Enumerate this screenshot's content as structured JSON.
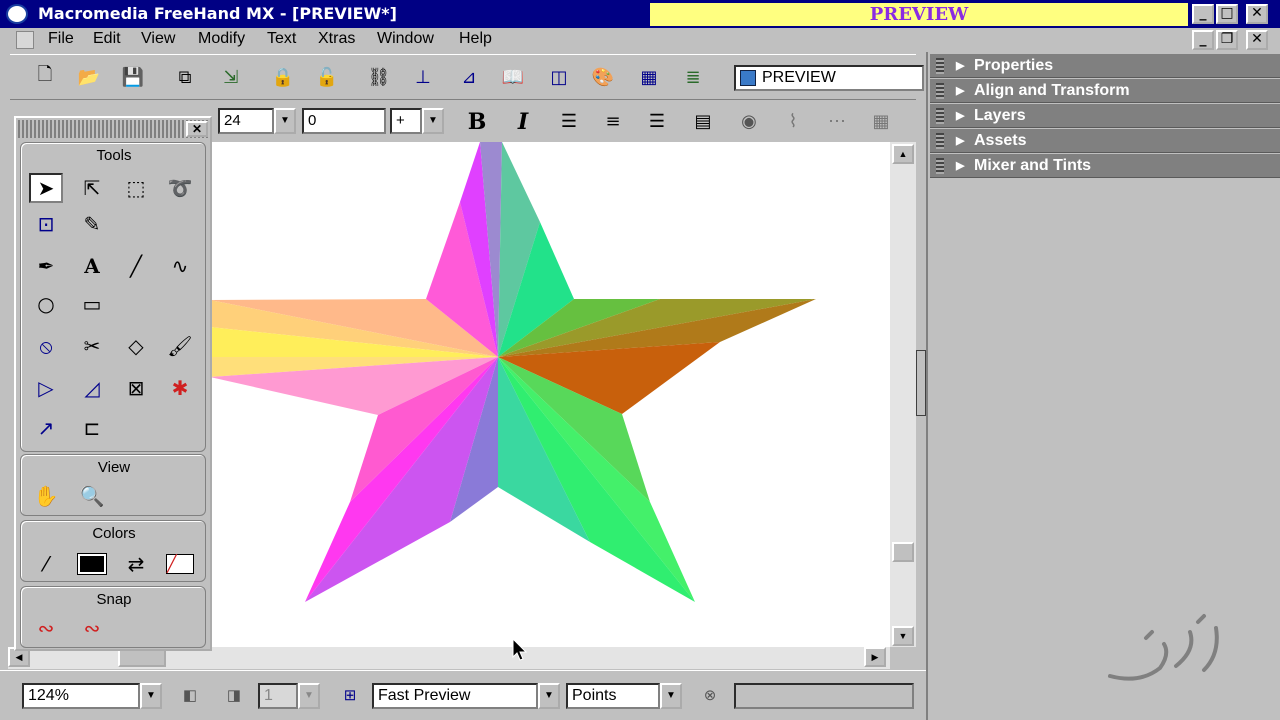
{
  "window": {
    "title": "Macromedia FreeHand MX - [PREVIEW*]",
    "banner": "PREVIEW",
    "controls": {
      "minimize": "_",
      "maximize": "□",
      "close": "✕",
      "restore": "❐"
    }
  },
  "menu": {
    "items": [
      "File",
      "Edit",
      "View",
      "Modify",
      "Text",
      "Xtras",
      "Window",
      "Help"
    ]
  },
  "main_toolbar": {
    "document_name": "PREVIEW",
    "icons": [
      "new-document-icon",
      "open-icon",
      "save-icon",
      "import-icon",
      "export-icon",
      "lock-icon",
      "unlock-icon",
      "group-icon",
      "align-icon",
      "transform-icon",
      "library-icon",
      "symbols-icon",
      "swatches-icon",
      "table-icon",
      "layers-icon"
    ]
  },
  "text_toolbar": {
    "font_size": "24",
    "leading": "0",
    "leading_mode": "+",
    "bold": "B",
    "italic": "I"
  },
  "tools_panel": {
    "title": "Tools",
    "view_title": "View",
    "colors_title": "Colors",
    "snap_title": "Snap"
  },
  "right_panel": {
    "items": [
      "Properties",
      "Align and Transform",
      "Layers",
      "Assets",
      "Mixer and Tints"
    ]
  },
  "status_bar": {
    "zoom": "124%",
    "page_number": "1",
    "preview_mode": "Fast Preview",
    "units": "Points"
  },
  "colors": {
    "titlebar": "#000084",
    "banner_bg": "#ffff80",
    "banner_text": "#8a2be2",
    "panel_header": "#808080"
  }
}
